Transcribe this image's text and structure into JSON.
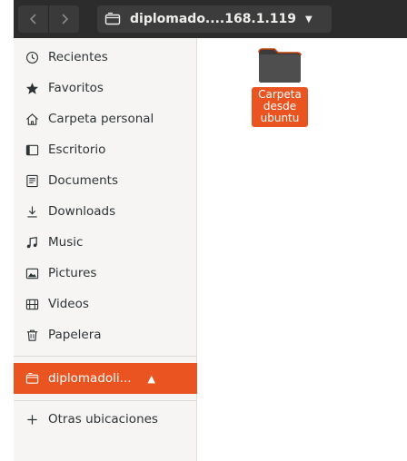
{
  "header": {
    "back_icon": "chevron-left-icon",
    "forward_icon": "chevron-right-icon",
    "path_label": "diplomado....168.1.119",
    "path_icon": "network-drive-icon",
    "path_menu_icon": "triangle-down-icon"
  },
  "sidebar": {
    "items": [
      {
        "label": "Recientes",
        "icon": "clock-icon"
      },
      {
        "label": "Favoritos",
        "icon": "star-icon"
      },
      {
        "label": "Carpeta personal",
        "icon": "home-icon"
      },
      {
        "label": "Escritorio",
        "icon": "desktop-icon"
      },
      {
        "label": "Documents",
        "icon": "document-icon"
      },
      {
        "label": "Downloads",
        "icon": "download-icon"
      },
      {
        "label": "Music",
        "icon": "music-icon"
      },
      {
        "label": "Pictures",
        "icon": "picture-icon"
      },
      {
        "label": "Videos",
        "icon": "film-icon"
      },
      {
        "label": "Papelera",
        "icon": "trash-icon"
      }
    ],
    "mounted": {
      "label": "diplomadoli...",
      "icon": "network-drive-icon",
      "eject_icon": "eject-icon"
    },
    "other": {
      "label": "Otras ubicaciones",
      "icon": "plus-icon"
    }
  },
  "files": [
    {
      "name": "Carpeta desde ubuntu",
      "icon": "folder-icon"
    }
  ],
  "colors": {
    "accent": "#e95420",
    "header": "#2c2c2c",
    "sidebar": "#f6f5f4",
    "folder": "#4a4a4a"
  }
}
